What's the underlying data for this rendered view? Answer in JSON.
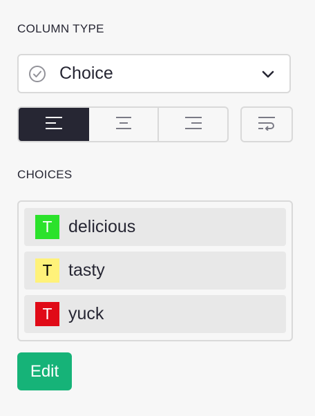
{
  "column_type": {
    "section_label": "COLUMN TYPE",
    "selected_type": "Choice",
    "type_icon": "check-circle-icon",
    "dropdown_icon": "chevron-down-icon"
  },
  "alignment": {
    "options": [
      {
        "name": "align-left",
        "icon": "align-left-icon",
        "selected": true
      },
      {
        "name": "align-center",
        "icon": "align-center-icon",
        "selected": false
      },
      {
        "name": "align-right",
        "icon": "align-right-icon",
        "selected": false
      }
    ],
    "wrap_icon": "wrap-text-icon"
  },
  "choices": {
    "section_label": "CHOICES",
    "items": [
      {
        "label": "delicious",
        "swatch_text": "T",
        "fill_color": "#2be22b",
        "text_color": "#ffffff"
      },
      {
        "label": "tasty",
        "swatch_text": "T",
        "fill_color": "#fff27a",
        "text_color": "#000000"
      },
      {
        "label": "yuck",
        "swatch_text": "T",
        "fill_color": "#e00a17",
        "text_color": "#ffffff"
      }
    ],
    "edit_label": "Edit"
  },
  "colors": {
    "accent": "#16b378",
    "selected_button": "#262633",
    "border": "#d9d9d9"
  }
}
